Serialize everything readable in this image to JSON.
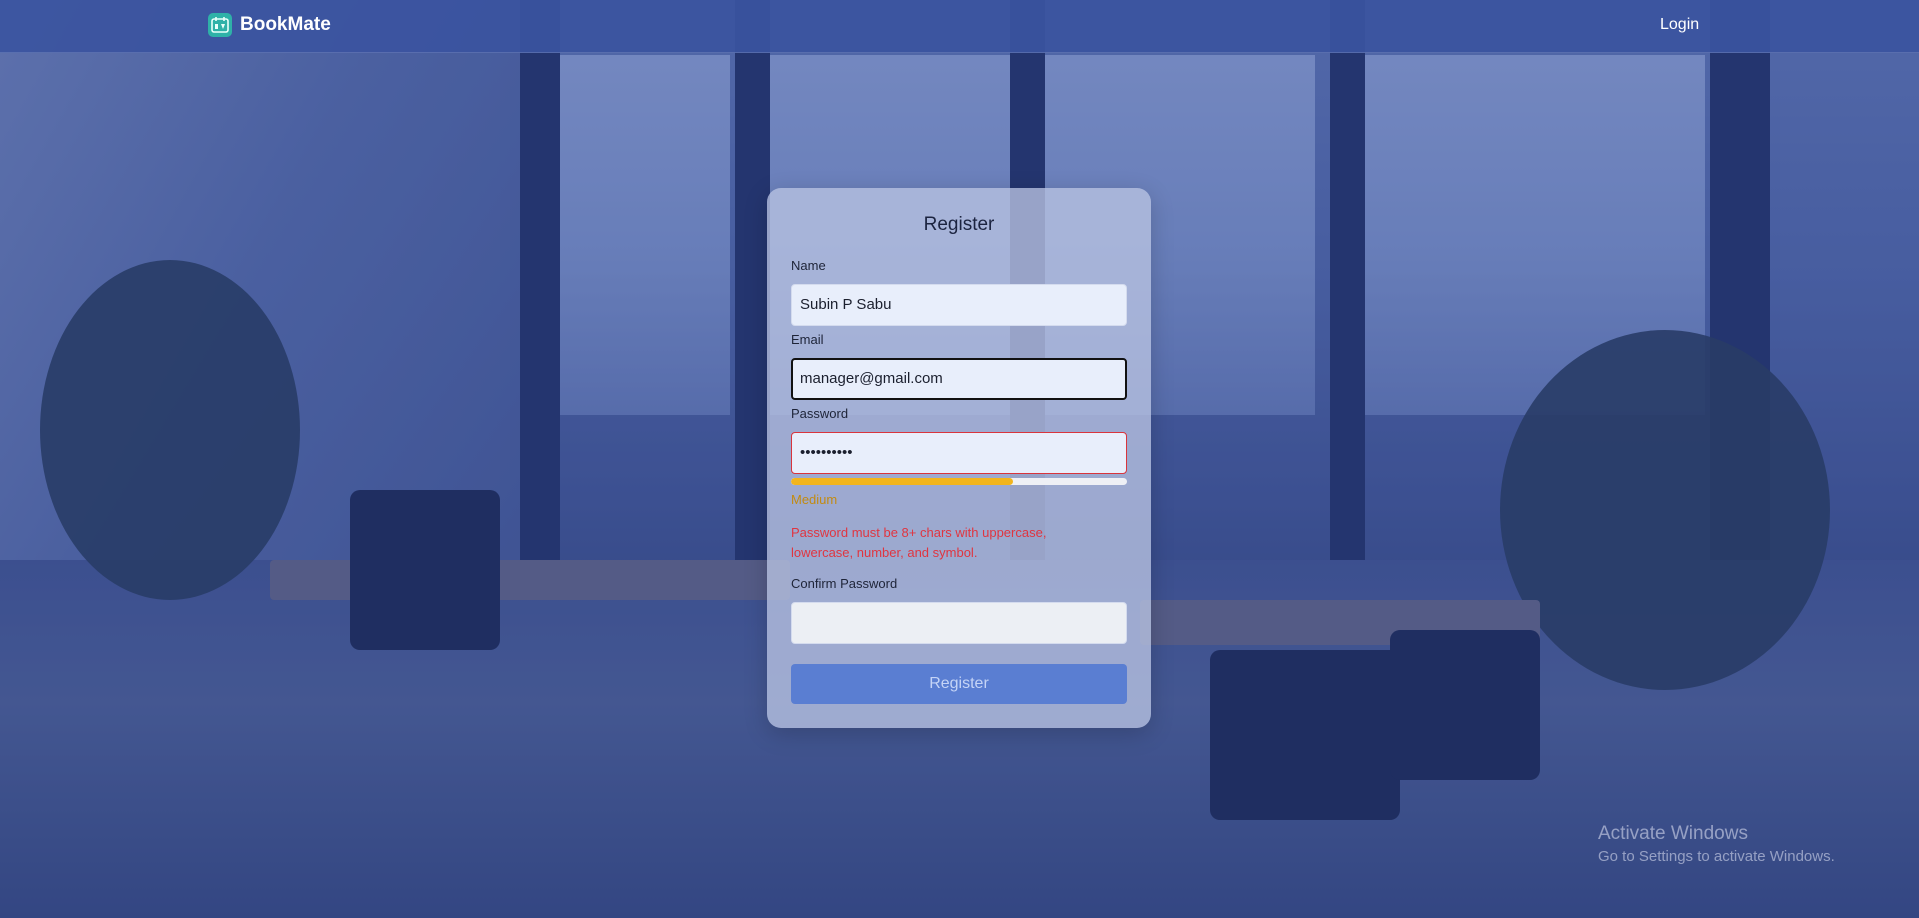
{
  "app": {
    "brand_name": "BookMate"
  },
  "nav": {
    "login_label": "Login"
  },
  "form": {
    "title": "Register",
    "name_label": "Name",
    "name_value": "Subin P Sabu",
    "email_label": "Email",
    "email_value": "manager@gmail.com",
    "password_label": "Password",
    "password_value": "••••••••••",
    "strength_text": "Medium",
    "strength_fraction": 0.66,
    "password_error": "Password must be 8+ chars with uppercase, lowercase, number, and symbol.",
    "confirm_label": "Confirm Password",
    "confirm_value": "",
    "submit_label": "Register"
  },
  "colors": {
    "topbar": "#3b54a0",
    "brand_icon": "#2fb1a8",
    "strength_bar": "#f2b51d",
    "error": "#e03540",
    "button": "#5a7ed2"
  },
  "watermark": {
    "line1": "Activate Windows",
    "line2": "Go to Settings to activate Windows."
  }
}
